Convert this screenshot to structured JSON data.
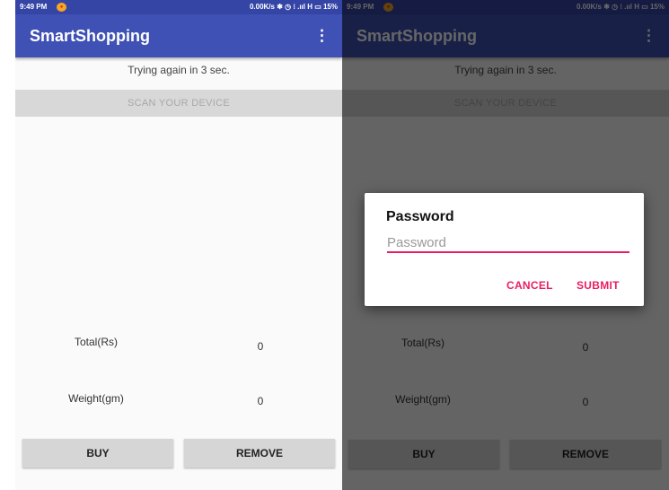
{
  "status_bar": {
    "time": "9:49 PM",
    "indicators": "0.00K/s ✱ ◷ ⁝ .ııl H ▭ 15%"
  },
  "app": {
    "title": "SmartShopping",
    "menu_icon": "more-vert-icon"
  },
  "main": {
    "status_message": "Trying again in 3 sec.",
    "scan_button": "SCAN YOUR DEVICE",
    "total_label": "Total(Rs)",
    "total_value": "0",
    "weight_label": "Weight(gm)",
    "weight_value": "0",
    "buy_button": "BUY",
    "remove_button": "REMOVE"
  },
  "dialog": {
    "title": "Password",
    "placeholder": "Password",
    "cancel_label": "CANCEL",
    "submit_label": "SUBMIT"
  },
  "colors": {
    "primary": "#3f51b5",
    "primary_dark": "#3545a6",
    "accent": "#e91e63"
  }
}
